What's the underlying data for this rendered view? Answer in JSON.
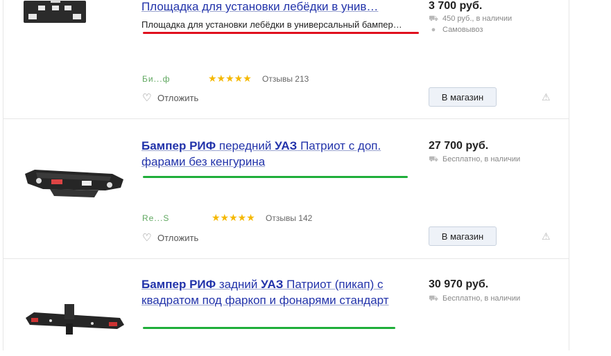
{
  "colors": {
    "link": "#2233aa",
    "red_underline": "#e0101e",
    "green_underline": "#1fae3a",
    "star": "#f5b800"
  },
  "items": [
    {
      "title_main": "Площадка для установки лебёдки в унив…",
      "snippet": "Площадка для установки лебёдки в универсальный бампер…",
      "price": "3 700 руб.",
      "delivery": "450 руб., в наличии",
      "pickup": "Самовывоз",
      "shop": "Би...ф",
      "stars": "★★★★★",
      "reviews": "Отзывы 213",
      "defer": "Отложить",
      "button": "В магазин",
      "delivery_icon": "truck-icon",
      "pickup_icon": "map-pin-icon"
    },
    {
      "title_b1": "Бампер РИФ",
      "title_t1": " передний ",
      "title_b2": "УАЗ",
      "title_t2": " Патриот с доп. фарами без кенгурина",
      "price": "27 700 руб.",
      "delivery": "Бесплатно, в наличии",
      "shop": "Re...S",
      "stars": "★★★★★",
      "reviews": "Отзывы 142",
      "defer": "Отложить",
      "button": "В магазин",
      "delivery_icon": "truck-icon"
    },
    {
      "title_b1": "Бампер РИФ",
      "title_t1": " задний ",
      "title_b2": "УАЗ",
      "title_t2": " Патриот (пикап) с квадратом под фаркоп и фонарями стандарт",
      "price": "30 970 руб.",
      "delivery": "Бесплатно, в наличии",
      "delivery_icon": "truck-icon"
    }
  ]
}
